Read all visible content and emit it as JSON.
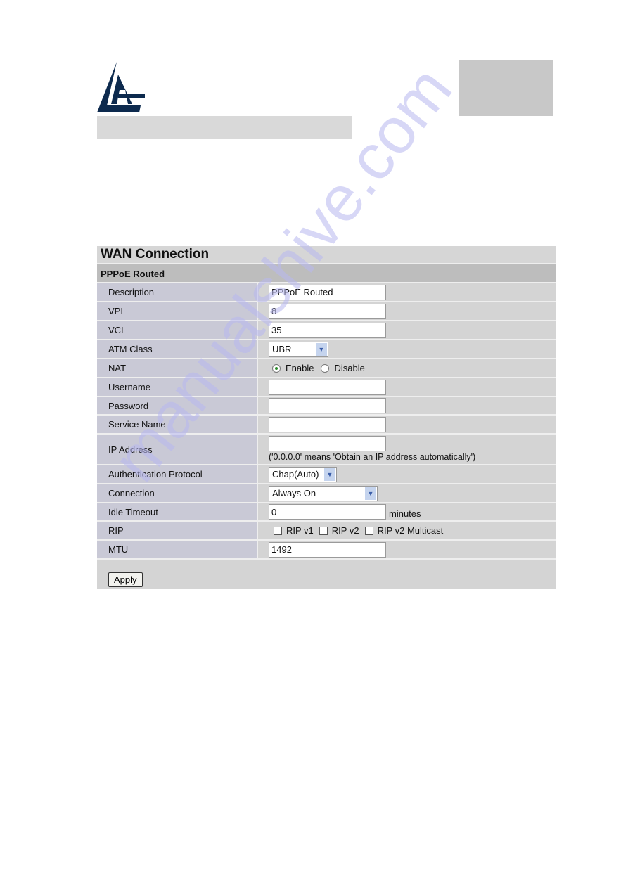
{
  "header": {
    "logo": "AL sailboat logo"
  },
  "panel": {
    "title": "WAN Connection",
    "subtitle": "PPPoE Routed",
    "fields": {
      "description": {
        "label": "Description",
        "value": "PPPoE Routed"
      },
      "vpi": {
        "label": "VPI",
        "value": "8"
      },
      "vci": {
        "label": "VCI",
        "value": "35"
      },
      "atm_class": {
        "label": "ATM Class",
        "value": "UBR"
      },
      "nat": {
        "label": "NAT",
        "enable": "Enable",
        "disable": "Disable",
        "selected": "Enable"
      },
      "username": {
        "label": "Username",
        "value": ""
      },
      "password": {
        "label": "Password",
        "value": ""
      },
      "service_name": {
        "label": "Service Name",
        "value": ""
      },
      "ip_address": {
        "label": "IP Address",
        "value": "",
        "hint": "('0.0.0.0' means 'Obtain an IP address automatically')"
      },
      "auth": {
        "label": "Authentication Protocol",
        "value": "Chap(Auto)"
      },
      "connection": {
        "label": "Connection",
        "value": "Always On"
      },
      "idle_timeout": {
        "label": "Idle Timeout",
        "value": "0",
        "unit": "minutes"
      },
      "rip": {
        "label": "RIP",
        "v1": "RIP v1",
        "v2": "RIP v2",
        "v2m": "RIP v2 Multicast",
        "checked": [
          false,
          false,
          false
        ]
      },
      "mtu": {
        "label": "MTU",
        "value": "1492"
      }
    },
    "apply_label": "Apply"
  },
  "watermark": "manualshive.com",
  "colors": {
    "logo": "#0d2a4e",
    "label_bg": "#c9c9d6",
    "value_bg": "#d4d4d4"
  }
}
